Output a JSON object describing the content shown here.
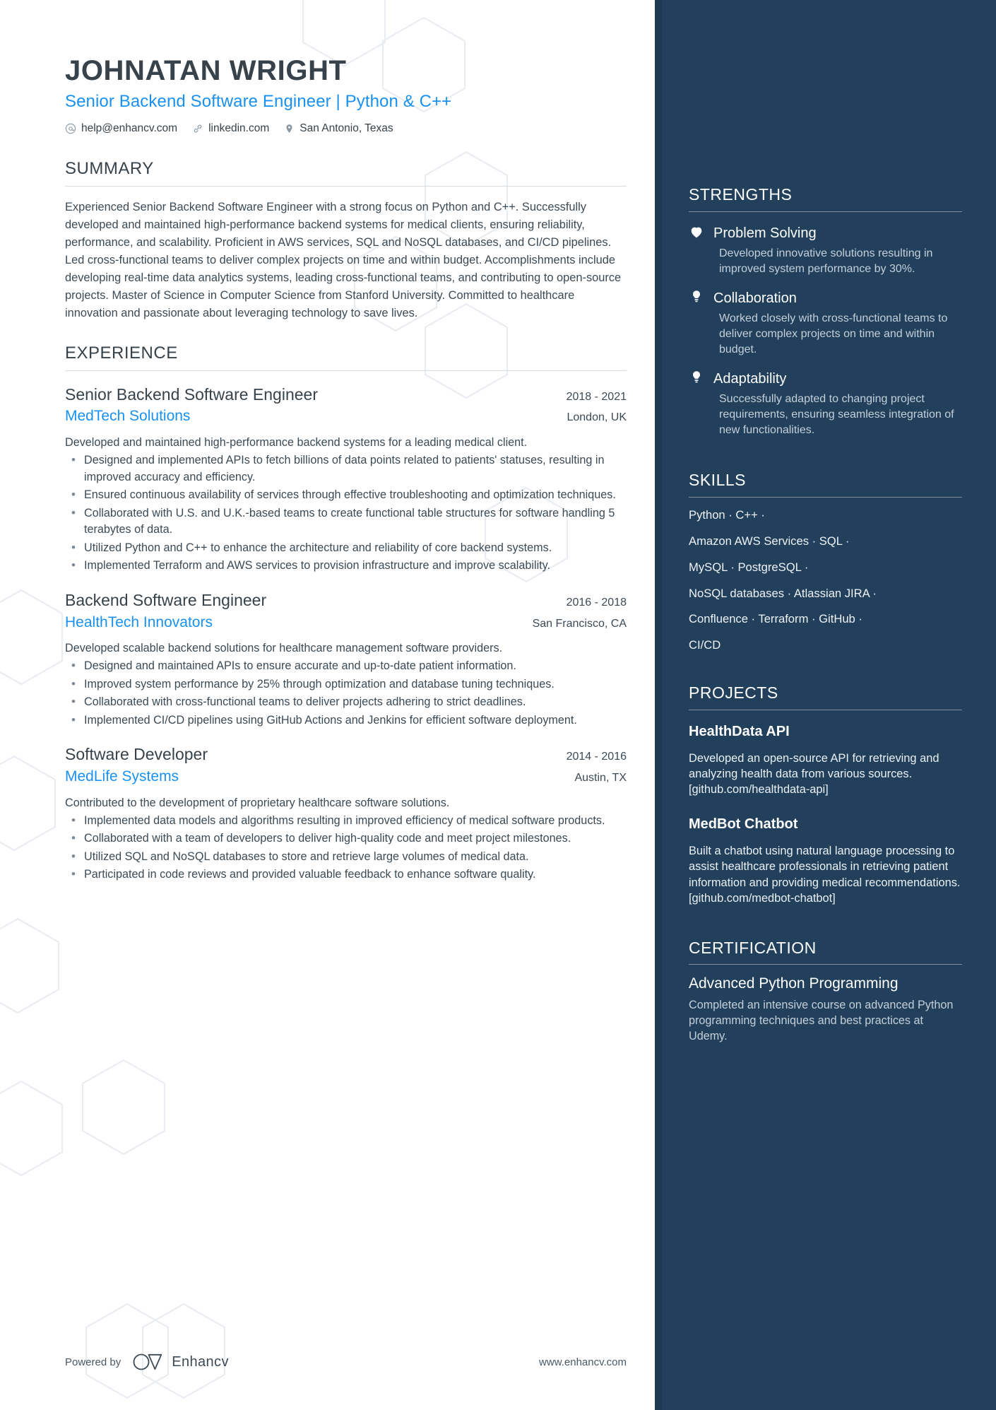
{
  "header": {
    "name": "JOHNATAN WRIGHT",
    "headline": "Senior Backend Software Engineer | Python & C++",
    "contacts": [
      {
        "icon": "at-icon",
        "text": "help@enhancv.com"
      },
      {
        "icon": "link-icon",
        "text": "linkedin.com"
      },
      {
        "icon": "location-pin-icon",
        "text": "San Antonio, Texas"
      }
    ]
  },
  "summary": {
    "title": "SUMMARY",
    "text": "Experienced Senior Backend Software Engineer with a strong focus on Python and C++. Successfully developed and maintained high-performance backend systems for medical clients, ensuring reliability, performance, and scalability. Proficient in AWS services, SQL and NoSQL databases, and CI/CD pipelines. Led cross-functional teams to deliver complex projects on time and within budget. Accomplishments include developing real-time data analytics systems, leading cross-functional teams, and contributing to open-source projects. Master of Science in Computer Science from Stanford University. Committed to healthcare innovation and passionate about leveraging technology to save lives."
  },
  "experience": {
    "title": "EXPERIENCE",
    "jobs": [
      {
        "title": "Senior Backend Software Engineer",
        "company": "MedTech Solutions",
        "dates": "2018 - 2021",
        "location": "London, UK",
        "description": "Developed and maintained high-performance backend systems for a leading medical client.",
        "bullets": [
          "Designed and implemented APIs to fetch billions of data points related to patients' statuses, resulting in improved accuracy and efficiency.",
          "Ensured continuous availability of services through effective troubleshooting and optimization techniques.",
          "Collaborated with U.S. and U.K.-based teams to create functional table structures for software handling 5 terabytes of data.",
          "Utilized Python and C++ to enhance the architecture and reliability of core backend systems.",
          "Implemented Terraform and AWS services to provision infrastructure and improve scalability."
        ]
      },
      {
        "title": "Backend Software Engineer",
        "company": "HealthTech Innovators",
        "dates": "2016 - 2018",
        "location": "San Francisco, CA",
        "description": "Developed scalable backend solutions for healthcare management software providers.",
        "bullets": [
          "Designed and maintained APIs to ensure accurate and up-to-date patient information.",
          "Improved system performance by 25% through optimization and database tuning techniques.",
          "Collaborated with cross-functional teams to deliver projects adhering to strict deadlines.",
          "Implemented CI/CD pipelines using GitHub Actions and Jenkins for efficient software deployment."
        ]
      },
      {
        "title": "Software Developer",
        "company": "MedLife Systems",
        "dates": "2014 - 2016",
        "location": "Austin, TX",
        "description": "Contributed to the development of proprietary healthcare software solutions.",
        "bullets": [
          "Implemented data models and algorithms resulting in improved efficiency of medical software products.",
          "Collaborated with a team of developers to deliver high-quality code and meet project milestones.",
          "Utilized SQL and NoSQL databases to store and retrieve large volumes of medical data.",
          "Participated in code reviews and provided valuable feedback to enhance software quality."
        ]
      }
    ]
  },
  "strengths": {
    "title": "STRENGTHS",
    "items": [
      {
        "icon": "heart-icon",
        "name": "Problem Solving",
        "description": "Developed innovative solutions resulting in improved system performance by 30%."
      },
      {
        "icon": "lightbulb-icon",
        "name": "Collaboration",
        "description": "Worked closely with cross-functional teams to deliver complex projects on time and within budget."
      },
      {
        "icon": "lightbulb-icon",
        "name": "Adaptability",
        "description": "Successfully adapted to changing project requirements, ensuring seamless integration of new functionalities."
      }
    ]
  },
  "skills": {
    "title": "SKILLS",
    "lines": [
      "Python · C++ ·",
      "Amazon AWS Services · SQL ·",
      "MySQL · PostgreSQL ·",
      "NoSQL databases · Atlassian JIRA ·",
      "Confluence · Terraform · GitHub ·",
      "CI/CD"
    ]
  },
  "projects": {
    "title": "PROJECTS",
    "items": [
      {
        "name": "HealthData API",
        "description": "Developed an open-source API for retrieving and analyzing health data from various sources. [github.com/healthdata-api]"
      },
      {
        "name": "MedBot Chatbot",
        "description": "Built a chatbot using natural language processing to assist healthcare professionals in retrieving patient information and providing medical recommendations. [github.com/medbot-chatbot]"
      }
    ]
  },
  "certification": {
    "title": "CERTIFICATION",
    "items": [
      {
        "name": "Advanced Python Programming",
        "description": "Completed an intensive course on advanced Python programming techniques and best practices at Udemy."
      }
    ]
  },
  "footer": {
    "powered_by": "Powered by",
    "brand": "Enhancv",
    "website": "www.enhancv.com"
  },
  "colors": {
    "accent": "#1a91f0",
    "sidebar_bg": "#22405c",
    "text": "#37424a"
  }
}
